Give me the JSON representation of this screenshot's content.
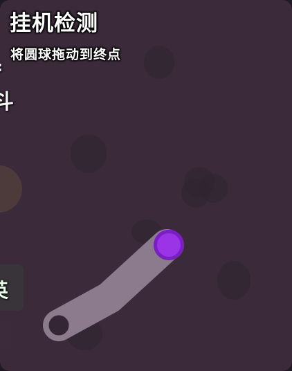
{
  "panel": {
    "title": "挂机检测",
    "subtitle": "将圆球拖动到终点"
  },
  "background_game": {
    "fragments": [
      ":",
      "斗",
      "英"
    ]
  },
  "colors": {
    "overlay": "#3f2c3e",
    "track": "#8b7b8c",
    "ball": "#9b33e6",
    "ball_ring": "#7a1fc4",
    "target": "#342634",
    "target_ring": "#8b7b8c",
    "yellow_button": "#b4a52c",
    "green_button": "#0f6a1a"
  },
  "icons": {
    "ball": "purple-circle",
    "target": "dark-circle-target"
  }
}
